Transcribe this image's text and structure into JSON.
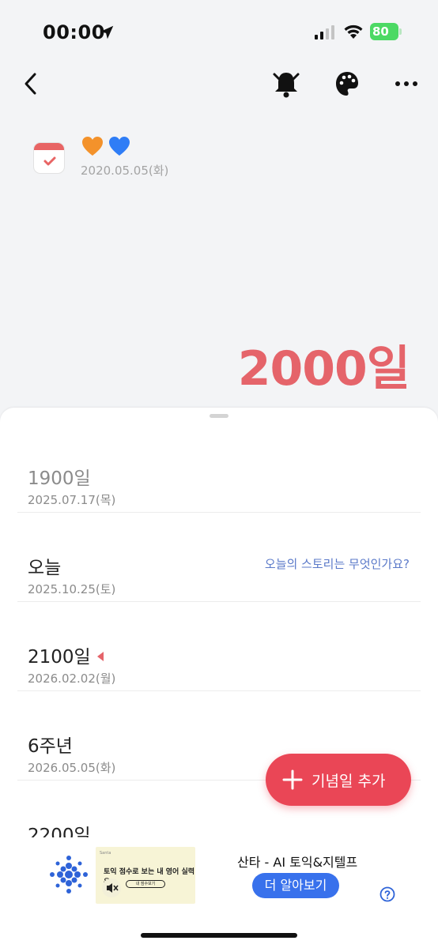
{
  "status_bar": {
    "time": "00:00",
    "battery_level": "80"
  },
  "header": {
    "date": "2020.05.05(화)",
    "count": "2000일",
    "accent_color": "#e5646a"
  },
  "list": [
    {
      "title": "1900일",
      "date": "2025.07.17(목)"
    },
    {
      "title": "오늘",
      "date": "2025.10.25(토)",
      "link": "오늘의 스토리는 무엇인가요?"
    },
    {
      "title": "2100일",
      "date": "2026.02.02(월)"
    },
    {
      "title": "6주년",
      "date": "2026.05.05(화)"
    },
    {
      "title": "2200일"
    }
  ],
  "add_button": {
    "label": "기념일 추가",
    "color": "#ea4656"
  },
  "ad": {
    "title": "산타 - AI 토익&지텔프",
    "cta": "더 알아보기",
    "image_text": "토익 점수로 보는 내 영어 실력은?",
    "image_button": "내 점수보기",
    "image_brand": "Santa"
  },
  "icons": [
    "back-icon",
    "bell-icon",
    "palette-icon",
    "more-icon",
    "calendar-icon",
    "orange-heart-icon",
    "blue-heart-icon",
    "plus-icon",
    "mute-icon",
    "help-icon"
  ]
}
